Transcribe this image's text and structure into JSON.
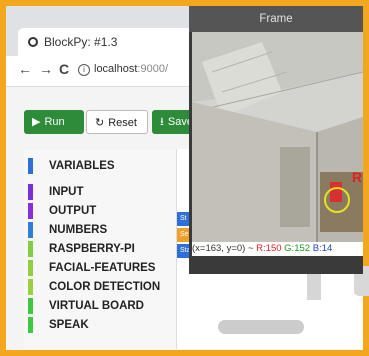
{
  "browser": {
    "tab_title": "BlockPy: #1.3",
    "tab_close": "×",
    "back": "←",
    "forward": "→",
    "reload": "C",
    "info_glyph": "i",
    "address_host": "localhost",
    "address_port": ":9000/"
  },
  "toolbar": {
    "run_label": "Run",
    "reset_label": "Reset",
    "save_label": "Save",
    "run_icon": "play-icon",
    "reset_icon": "refresh-icon",
    "save_icon": "upload-icon"
  },
  "categories": [
    {
      "label": "VARIABLES",
      "color": "#2f6fd8"
    },
    {
      "label": "INPUT",
      "color": "#7b2fd8"
    },
    {
      "label": "OUTPUT",
      "color": "#8a2fd8"
    },
    {
      "label": "NUMBERS",
      "color": "#2f7fd8"
    },
    {
      "label": "RASPBERRY-PI",
      "color": "#7fcf40"
    },
    {
      "label": "FACIAL-FEATURES",
      "color": "#8fd040"
    },
    {
      "label": "COLOR DETECTION",
      "color": "#9ad040"
    },
    {
      "label": "VIRTUAL BOARD",
      "color": "#3fc83f"
    },
    {
      "label": "SPEAK",
      "color": "#3fc83f"
    }
  ],
  "blocks": [
    {
      "label": "St",
      "color": "#2f6fd8"
    },
    {
      "label": "Se",
      "color": "#f0a02a"
    },
    {
      "label": "Start Detection",
      "color": "#2f6fd8"
    }
  ],
  "frame": {
    "title": "Frame",
    "status_coords": "(x=163, y=0) ~",
    "status_r": "R:150",
    "status_g": "G:152",
    "status_b": "B:14",
    "overlay_text": "R"
  }
}
